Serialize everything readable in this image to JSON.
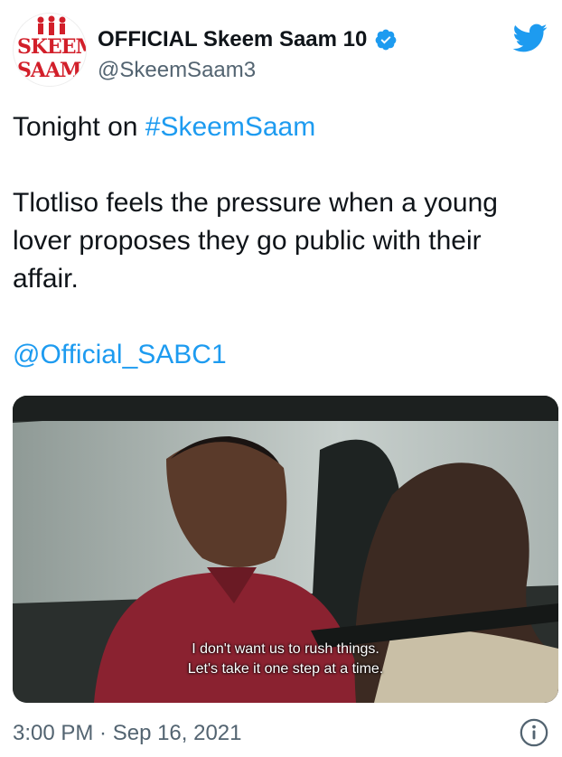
{
  "account": {
    "display_name": "OFFICIAL Skeem Saam 10",
    "handle": "@SkeemSaam3",
    "avatar_top": "SKEEM",
    "avatar_bottom": "SAAM"
  },
  "tweet": {
    "line1_prefix": "Tonight on ",
    "line1_hashtag": "#SkeemSaam",
    "body": "Tlotliso feels the pressure when a young lover proposes they go public with their affair.",
    "mention": "@Official_SABC1"
  },
  "media": {
    "subtitle_line1": "I don't want us to rush things.",
    "subtitle_line2": "Let's take it one step at a time."
  },
  "footer": {
    "timestamp": "3:00 PM · Sep 16, 2021"
  },
  "colors": {
    "link": "#1d9bf0",
    "verified": "#1d9bf0",
    "brand_red": "#d21f2a"
  },
  "icons": [
    "verified-badge-icon",
    "twitter-bird-icon",
    "info-icon"
  ]
}
